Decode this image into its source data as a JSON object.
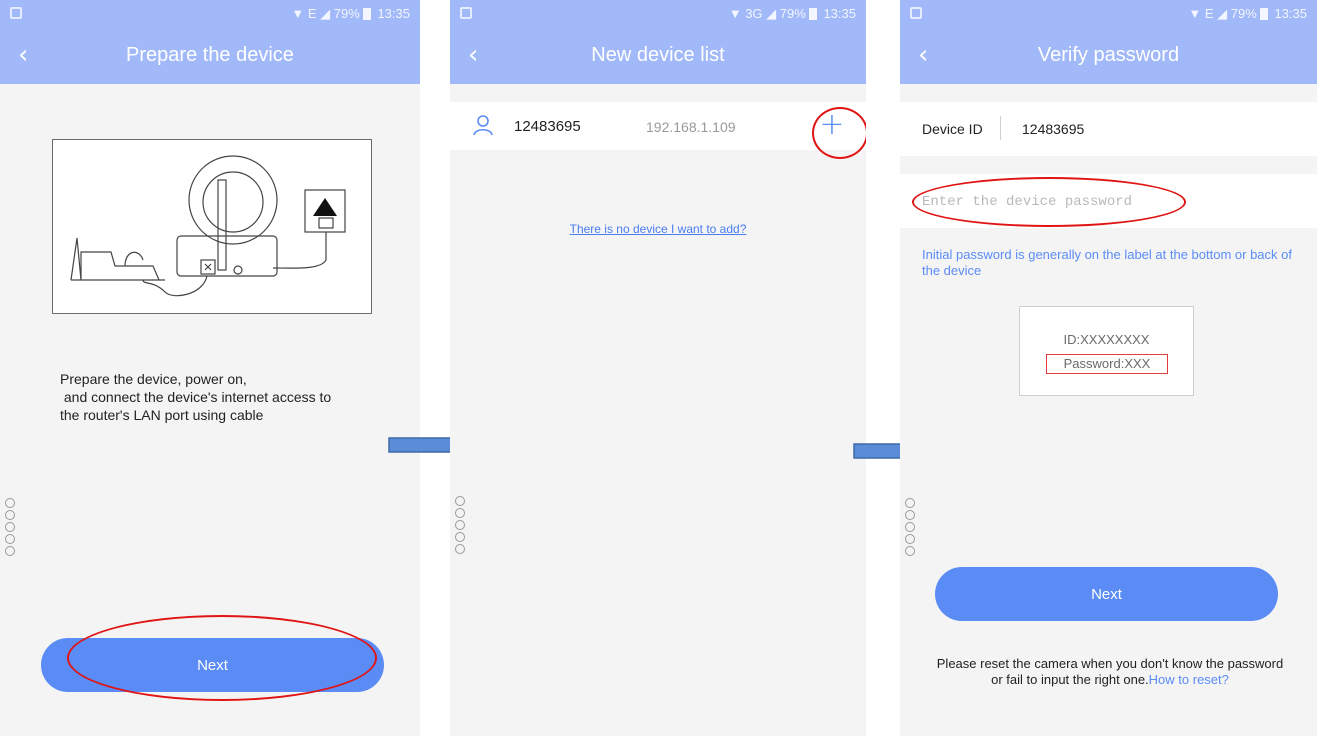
{
  "screens": [
    {
      "status": {
        "network": "E",
        "battery": "79%",
        "time": "13:35"
      },
      "title": "Prepare the device",
      "instructions": [
        "Prepare the device, power on,",
        " and connect the device's internet access to",
        "the router's LAN port using cable"
      ],
      "next_label": "Next"
    },
    {
      "status": {
        "network": "3G",
        "battery": "79%",
        "time": "13:35"
      },
      "title": "New device list",
      "device": {
        "id": "12483695",
        "ip": "192.168.1.109"
      },
      "no_device_link": "There is no device I want to add?"
    },
    {
      "status": {
        "network": "E",
        "battery": "79%",
        "time": "13:35"
      },
      "title": "Verify password",
      "device_id_label": "Device ID",
      "device_id_value": "12483695",
      "password_placeholder": "Enter the device password",
      "hint": "Initial password is generally on the label at the bottom or back of the device",
      "label_card": {
        "id": "ID:XXXXXXXX",
        "password": "Password:XXX"
      },
      "next_label": "Next",
      "reset_text": "Please reset the camera when you don't know the password or fail to input the right one.",
      "reset_link": "How to reset?"
    }
  ],
  "colors": {
    "header": "#a1b8f9",
    "accent": "#5b8cf6",
    "highlight_oval": "#e11414",
    "flow_arrow": "#4a7ebb"
  }
}
